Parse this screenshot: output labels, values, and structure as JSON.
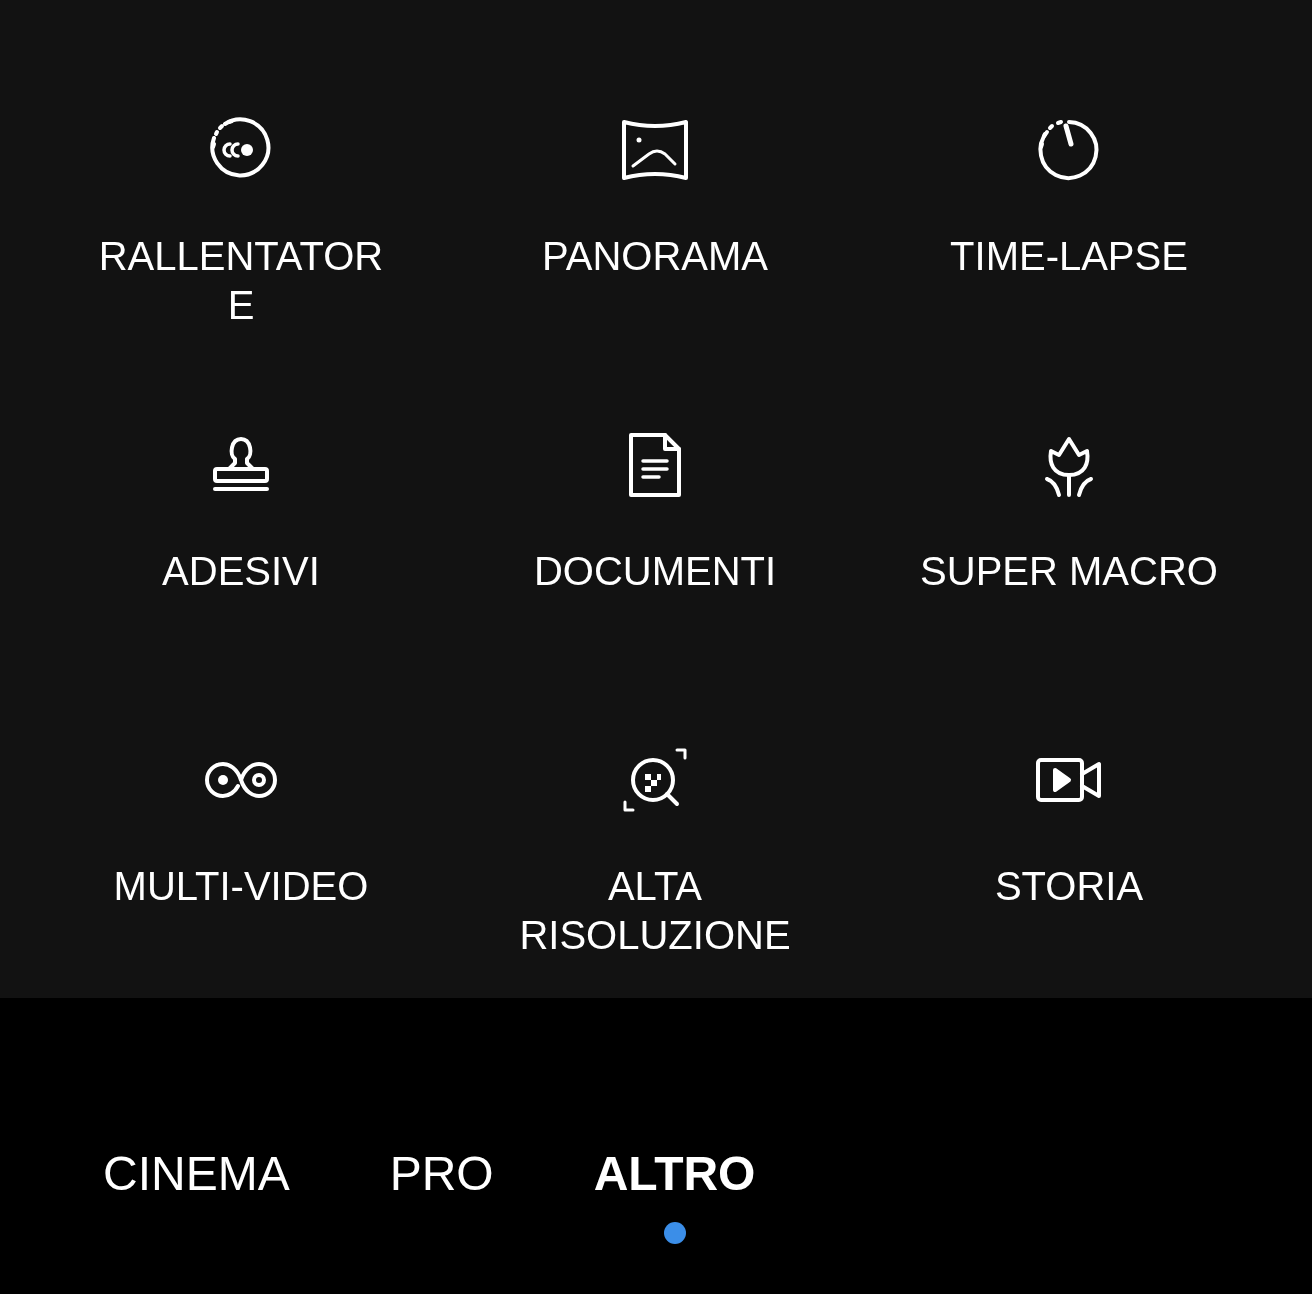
{
  "modes": [
    {
      "label": "RALLENTATOR\nE"
    },
    {
      "label": "PANORAMA"
    },
    {
      "label": "TIME-LAPSE"
    },
    {
      "label": "ADESIVI"
    },
    {
      "label": "DOCUMENTI"
    },
    {
      "label": "SUPER MACRO"
    },
    {
      "label": "MULTI-VIDEO"
    },
    {
      "label": "ALTA\nRISOLUZIONE"
    },
    {
      "label": "STORIA"
    }
  ],
  "tabs": [
    {
      "label": "CINEMA",
      "selected": false
    },
    {
      "label": "PRO",
      "selected": false
    },
    {
      "label": "ALTRO",
      "selected": true
    }
  ]
}
